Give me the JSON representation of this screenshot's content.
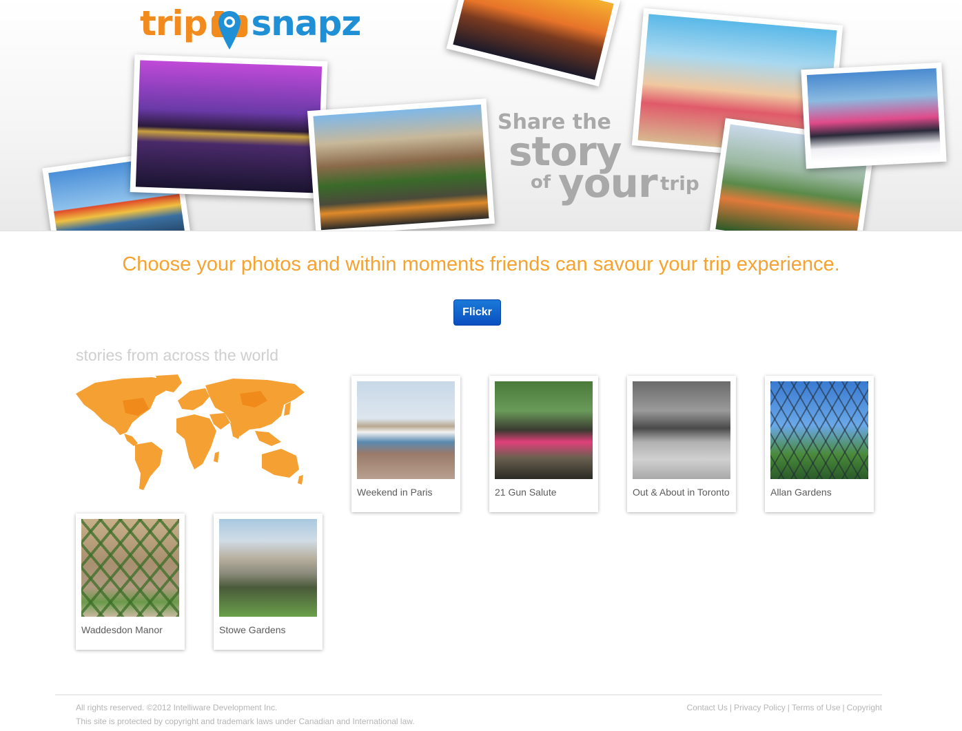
{
  "brand": {
    "word1": "trip",
    "word2": "snapz",
    "orange": "#f28b1e",
    "blue": "#1f8fd6"
  },
  "hero": {
    "tagline": [
      "Share the",
      "story",
      "of",
      "your",
      "trip"
    ],
    "photos": [
      "copenhagen-harbour",
      "berlin-cathedral-night",
      "amsterdam-canal-bicycle",
      "paris-eiffel-sunset",
      "girl-snorkel-beach",
      "hikers-mountain",
      "family-skiing"
    ]
  },
  "main": {
    "headline": "Choose your photos and within moments friends can savour your trip experience.",
    "flickr_button": "Flickr",
    "section_title": "stories from across the world",
    "accent": "#f5a230",
    "button_color": "#0a4fc0"
  },
  "stories": [
    {
      "title": "Weekend in Paris"
    },
    {
      "title": "21 Gun Salute"
    },
    {
      "title": "Out & About in Toronto"
    },
    {
      "title": "Allan Gardens"
    },
    {
      "title": "Waddesdon Manor"
    },
    {
      "title": "Stowe Gardens"
    }
  ],
  "footer": {
    "rights": "All rights reserved. ©2012 Intelliware Development Inc.",
    "protection": "This site is protected by copyright and trademark laws under Canadian and International law.",
    "links": [
      "Contact Us",
      "Privacy Policy",
      "Terms of Use",
      "Copyright"
    ]
  }
}
